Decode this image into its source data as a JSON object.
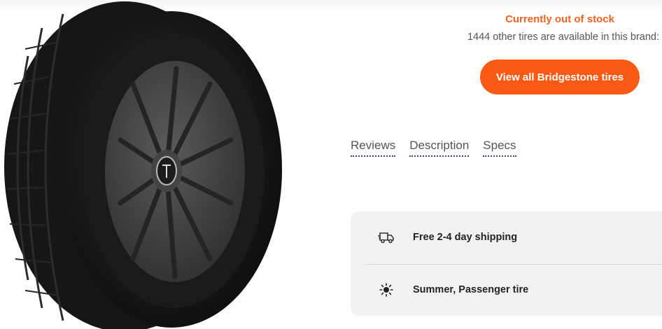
{
  "stock": {
    "status": "Currently out of stock",
    "availability": "1444 other tires are available in this brand:"
  },
  "actions": {
    "view_all_label": "View all Bridgestone tires"
  },
  "tabs": [
    {
      "label": "Reviews"
    },
    {
      "label": "Description"
    },
    {
      "label": "Specs"
    }
  ],
  "features": [
    {
      "icon": "truck-icon",
      "label": "Free 2-4 day shipping"
    },
    {
      "icon": "sun-icon",
      "label": "Summer, Passenger tire"
    }
  ],
  "colors": {
    "accent": "#fa5a14",
    "status": "#f26322",
    "card_bg": "#f2f2f2"
  }
}
